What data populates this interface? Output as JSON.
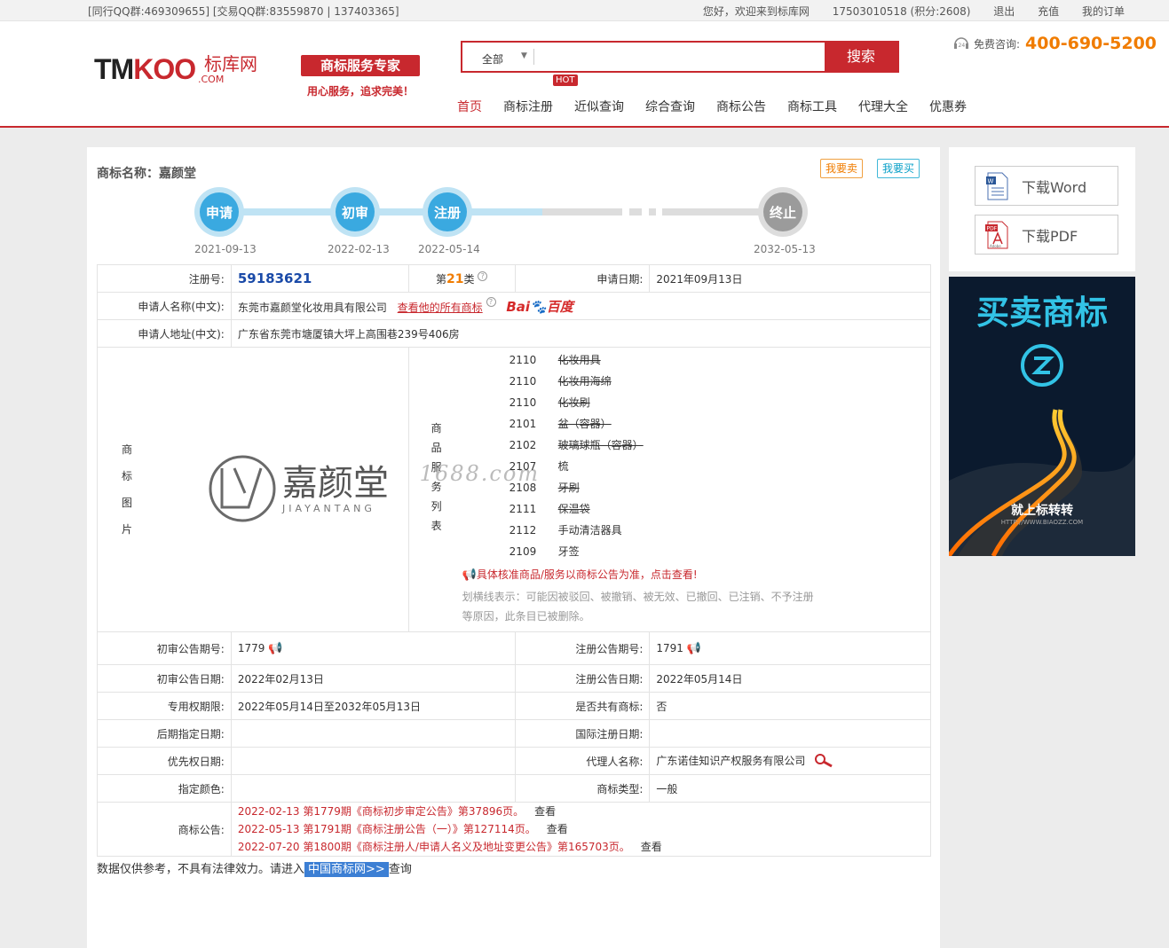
{
  "topbar": {
    "left": "[同行QQ群:469309655] [交易QQ群:83559870 | 137403365]",
    "greeting": "您好，欢迎来到标库网",
    "account": "17503010518 (积分:2608)",
    "logout": "退出",
    "recharge": "充值",
    "orders": "我的订单"
  },
  "header": {
    "logo_tm": "TM",
    "logo_koo": "KOO",
    "logo_cn": "标库网",
    "logo_com": ".COM",
    "slogan_badge": "商标服务专家",
    "slogan_sub": "用心服务，追求完美！",
    "search_scope": "全部",
    "search_value": "",
    "search_button": "搜索",
    "hotline_label": "免费咨询:",
    "hotline_number": "400-690-5200",
    "hot_badge": "HOT",
    "nav": [
      "首页",
      "商标注册",
      "近似查询",
      "综合查询",
      "商标公告",
      "商标工具",
      "代理大全",
      "优惠券"
    ]
  },
  "detail": {
    "title": "商标名称：嘉颜堂",
    "sell": "我要卖",
    "buy": "我要买",
    "flow": [
      {
        "label": "申请",
        "date": "2021-09-13",
        "active": true
      },
      {
        "label": "初审",
        "date": "2022-02-13",
        "active": true
      },
      {
        "label": "注册",
        "date": "2022-05-14",
        "active": true
      },
      {
        "label": "终止",
        "date": "2032-05-13",
        "active": false
      }
    ],
    "reg_no_label": "注册号:",
    "reg_no": "59183621",
    "class_prefix": "第",
    "class_no": "21",
    "class_suffix": "类",
    "apply_date_label": "申请日期:",
    "apply_date": "2021年09月13日",
    "applicant_label": "申请人名称(中文):",
    "applicant": "东莞市嘉颜堂化妆用具有限公司",
    "all_marks_link": "查看他的所有商标",
    "baidu_a": "Bai",
    "baidu_b": "百度",
    "address_label": "申请人地址(中文):",
    "address": "广东省东莞市塘厦镇大坪上高围巷239号406房",
    "image_label": [
      "商",
      "标",
      "图",
      "片"
    ],
    "mark_cn": "嘉颜堂",
    "mark_en": "JIAYANTANG",
    "goods_label": [
      "商",
      "品",
      "服",
      "务",
      "列",
      "表"
    ],
    "goods": [
      {
        "code": "2110",
        "name": "化妆用具",
        "struck": true
      },
      {
        "code": "2110",
        "name": "化妆用海绵",
        "struck": true
      },
      {
        "code": "2110",
        "name": "化妆刷",
        "struck": true
      },
      {
        "code": "2101",
        "name": "盆（容器）",
        "struck": true
      },
      {
        "code": "2102",
        "name": "玻璃球瓶（容器）",
        "struck": true
      },
      {
        "code": "2107",
        "name": "梳",
        "struck": false
      },
      {
        "code": "2108",
        "name": "牙刷",
        "struck": true
      },
      {
        "code": "2111",
        "name": "保温袋",
        "struck": true
      },
      {
        "code": "2112",
        "name": "手动清洁器具",
        "struck": false
      },
      {
        "code": "2109",
        "name": "牙签",
        "struck": false
      }
    ],
    "watermark": "1688.com",
    "goods_notice": "具体核准商品/服务以商标公告为准，点击查看!",
    "strike_note": "划横线表示：可能因被驳回、被撤销、被无效、已撤回、已注销、不予注册等原因，此条目已被删除。",
    "prelim_no_label": "初审公告期号:",
    "prelim_no": "1779",
    "reg_ann_no_label": "注册公告期号:",
    "reg_ann_no": "1791",
    "prelim_date_label": "初审公告日期:",
    "prelim_date": "2022年02月13日",
    "reg_ann_date_label": "注册公告日期:",
    "reg_ann_date": "2022年05月14日",
    "term_label": "专用权期限:",
    "term": "2022年05月14日至2032年05月13日",
    "shared_label": "是否共有商标:",
    "shared": "否",
    "later_label": "后期指定日期:",
    "later": "",
    "intl_label": "国际注册日期:",
    "intl": "",
    "priority_label": "优先权日期:",
    "priority": "",
    "agent_label": "代理人名称:",
    "agent": "广东诺佳知识产权服务有限公司",
    "color_label": "指定颜色:",
    "color": "",
    "type_label": "商标类型:",
    "type": "一般",
    "announce_label": "商标公告:",
    "announcements": [
      "2022-02-13 第1779期《商标初步审定公告》第37896页。",
      "2022-05-13 第1791期《商标注册公告（一）》第127114页。",
      "2022-07-20 第1800期《商标注册人/申请人名义及地址变更公告》第165703页。"
    ],
    "see": "查看",
    "foot_text": "数据仅供参考，不具有法律效力。请进入",
    "foot_link": "中国商标网>>",
    "foot_end": "查询"
  },
  "side": {
    "word": "下载Word",
    "pdf": "下载PDF",
    "pdf_badge": "PDF",
    "adobe": "Adobe",
    "ad_title": "买卖商标",
    "ad_bottom": "就上标转转",
    "ad_url": "HTTP://WWW.BIAOZZ.COM"
  },
  "colors": {
    "brand": "#c8282e",
    "flow_active": "#3aa9e0",
    "hotline": "#f07c00",
    "reg_no": "#1a4aa8"
  }
}
